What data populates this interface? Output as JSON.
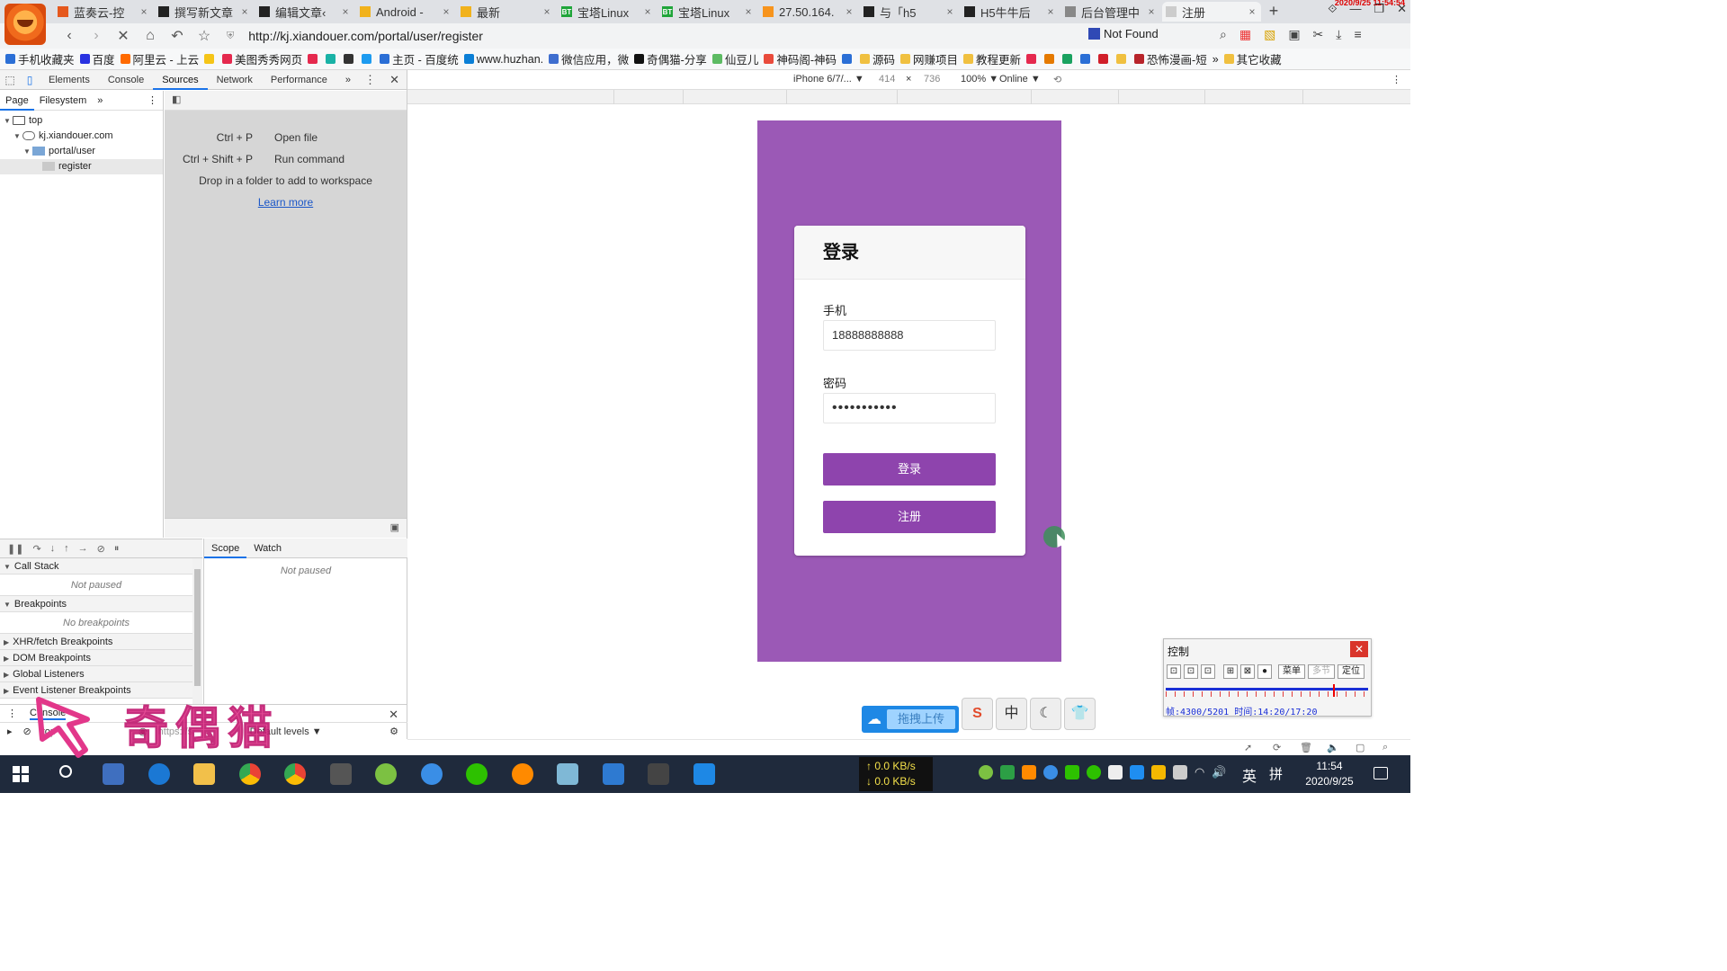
{
  "browser": {
    "tabs": [
      {
        "title": "蓝奏云-控",
        "color": "#e5581d"
      },
      {
        "title": "撰写新文章",
        "color": "#222222"
      },
      {
        "title": "编辑文章‹",
        "color": "#222222"
      },
      {
        "title": "Android -",
        "color": "#f1b21c"
      },
      {
        "title": "最新",
        "color": "#f1b21c"
      },
      {
        "title": "宝塔Linux",
        "color": "#20a53a",
        "badge": "BT"
      },
      {
        "title": "宝塔Linux",
        "color": "#20a53a",
        "badge": "BT"
      },
      {
        "title": "27.50.164.",
        "color": "#f7941d"
      },
      {
        "title": "与「h5",
        "color": "#222222"
      },
      {
        "title": "H5牛牛后",
        "color": "#222222"
      },
      {
        "title": "后台管理中",
        "color": "#888888"
      },
      {
        "title": "注册",
        "color": "#cccccc",
        "active": true
      }
    ],
    "new_tab": "+",
    "window_controls": [
      "⟐",
      "—",
      "❐",
      "✕"
    ],
    "clock_overlay": "2020/9/25 11:54:54",
    "url": "http://kj.xiandouer.com/portal/user/register",
    "not_found_label": "Not Found",
    "bookmarks": [
      {
        "label": "手机收藏夹",
        "color": "#2b6fd6"
      },
      {
        "label": "百度",
        "color": "#2932e1"
      },
      {
        "label": "阿里云 - 上云",
        "color": "#ff6a00"
      },
      {
        "label": "",
        "color": "#f5c518"
      },
      {
        "label": "美图秀秀网页",
        "color": "#e5294e"
      },
      {
        "label": "",
        "color": "#e5294e"
      },
      {
        "label": "",
        "color": "#19b2a6"
      },
      {
        "label": "",
        "color": "#333333"
      },
      {
        "label": "",
        "color": "#1d9bf0"
      },
      {
        "label": "主页 - 百度统",
        "color": "#2b6fd6"
      },
      {
        "label": "www.huzhan.",
        "color": "#0b7fd6"
      },
      {
        "label": "微信应用，微",
        "color": "#3f6ecf"
      },
      {
        "label": "奇偶猫-分享",
        "color": "#111111"
      },
      {
        "label": "仙豆儿",
        "color": "#5dbb63"
      },
      {
        "label": "神码阁-神码",
        "color": "#e94b3c"
      },
      {
        "label": "",
        "color": "#2b6fd6"
      },
      {
        "label": "源码",
        "color": "#f0c040"
      },
      {
        "label": "网赚项目",
        "color": "#f0c040"
      },
      {
        "label": "教程更新",
        "color": "#f0c040"
      },
      {
        "label": "",
        "color": "#e5294e"
      },
      {
        "label": "",
        "color": "#e57a00"
      },
      {
        "label": "",
        "color": "#1aa260"
      },
      {
        "label": "",
        "color": "#2b6fd6"
      },
      {
        "label": "",
        "color": "#d11f2a"
      },
      {
        "label": "",
        "color": "#f0c040"
      },
      {
        "label": "恐怖漫画-短",
        "color": "#b8242b"
      },
      {
        "label": "»",
        "color": ""
      },
      {
        "label": "其它收藏",
        "color": "#f0c040"
      }
    ]
  },
  "devtools": {
    "tabs": [
      "Elements",
      "Console",
      "Sources",
      "Network",
      "Performance"
    ],
    "active_tab": "Sources",
    "more": "»",
    "nav_subtabs": [
      "Page",
      "Filesystem"
    ],
    "tree": [
      {
        "label": "top",
        "depth": 0,
        "arrow": "▼"
      },
      {
        "label": "kj.xiandouer.com",
        "depth": 1,
        "arrow": "▼"
      },
      {
        "label": "portal/user",
        "depth": 2,
        "arrow": "▼"
      },
      {
        "label": "register",
        "depth": 3,
        "arrow": "",
        "selected": true
      }
    ],
    "hints": [
      {
        "key": "Ctrl + P",
        "action": "Open file"
      },
      {
        "key": "Ctrl + Shift + P",
        "action": "Run command"
      }
    ],
    "drop_text": "Drop in a folder to add to workspace",
    "learn_more": "Learn more",
    "scope_tabs": [
      "Scope",
      "Watch"
    ],
    "not_paused": "Not paused",
    "sections": [
      {
        "title": "Call Stack",
        "open": true,
        "body": "Not paused"
      },
      {
        "title": "Breakpoints",
        "open": true,
        "body": "No breakpoints"
      },
      {
        "title": "XHR/fetch Breakpoints",
        "open": false
      },
      {
        "title": "DOM Breakpoints",
        "open": false
      },
      {
        "title": "Global Listeners",
        "open": false
      },
      {
        "title": "Event Listener Breakpoints",
        "open": false
      }
    ],
    "console_tab": "Console",
    "console_context": "top",
    "console_filter": "https://s",
    "console_levels": "Default levels ▼"
  },
  "device_toolbar": {
    "device": "iPhone 6/7/... ▼",
    "width": "414",
    "times": "×",
    "height": "736",
    "zoom": "100% ▼",
    "network": "Online ▼"
  },
  "login": {
    "title": "登录",
    "phone_label": "手机",
    "phone_value": "18888888888",
    "password_label": "密码",
    "password_value": "•••••••••••",
    "login_button": "登录",
    "register_button": "注册",
    "colors": {
      "page_bg": "#9b59b6",
      "button": "#8e44ad"
    }
  },
  "overlay_tools": {
    "upload_label": "拖拽上传",
    "ime_buttons": [
      "S",
      "中",
      "☾",
      "👕"
    ],
    "control_title": "控制",
    "control_buttons": [
      "⊡",
      "⊡",
      "⊡",
      "⊞",
      "⊠",
      "●",
      "菜单",
      "多节",
      "定位"
    ],
    "control_status": "帧:4300/5201 时间:14:20/17:20",
    "control_progress": 0.826,
    "watermark": "奇偶猫"
  },
  "taskbar": {
    "net_up": "↑ 0.0 KB/s",
    "net_down": "↓ 0.0 KB/s",
    "lang": "英",
    "ime": "拼",
    "time": "11:54",
    "date": "2020/9/25"
  }
}
